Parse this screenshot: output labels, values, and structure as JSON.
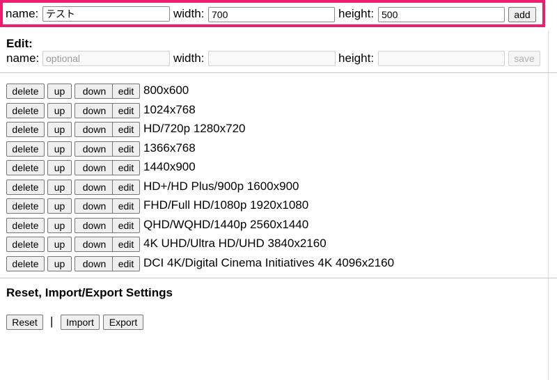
{
  "add_form": {
    "name_label": "name:",
    "name_value": "テスト",
    "width_label": "width:",
    "width_value": "700",
    "height_label": "height:",
    "height_value": "500",
    "add_label": "add"
  },
  "edit_form": {
    "heading": "Edit:",
    "name_label": "name:",
    "name_placeholder": "optional",
    "width_label": "width:",
    "height_label": "height:",
    "save_label": "save"
  },
  "row_buttons": {
    "delete": "delete",
    "up": "up",
    "down": "down",
    "edit": "edit"
  },
  "resolutions": [
    "800x600",
    "1024x768",
    "HD/720p 1280x720",
    "1366x768",
    "1440x900",
    "HD+/HD Plus/900p 1600x900",
    "FHD/Full HD/1080p 1920x1080",
    "QHD/WQHD/1440p 2560x1440",
    "4K UHD/Ultra HD/UHD 3840x2160",
    "DCI 4K/Digital Cinema Initiatives 4K 4096x2160"
  ],
  "settings": {
    "heading": "Reset, Import/Export Settings",
    "reset_label": "Reset",
    "separator": "|",
    "import_label": "Import",
    "export_label": "Export"
  },
  "colors": {
    "highlight_border": "#ee1e6e"
  }
}
